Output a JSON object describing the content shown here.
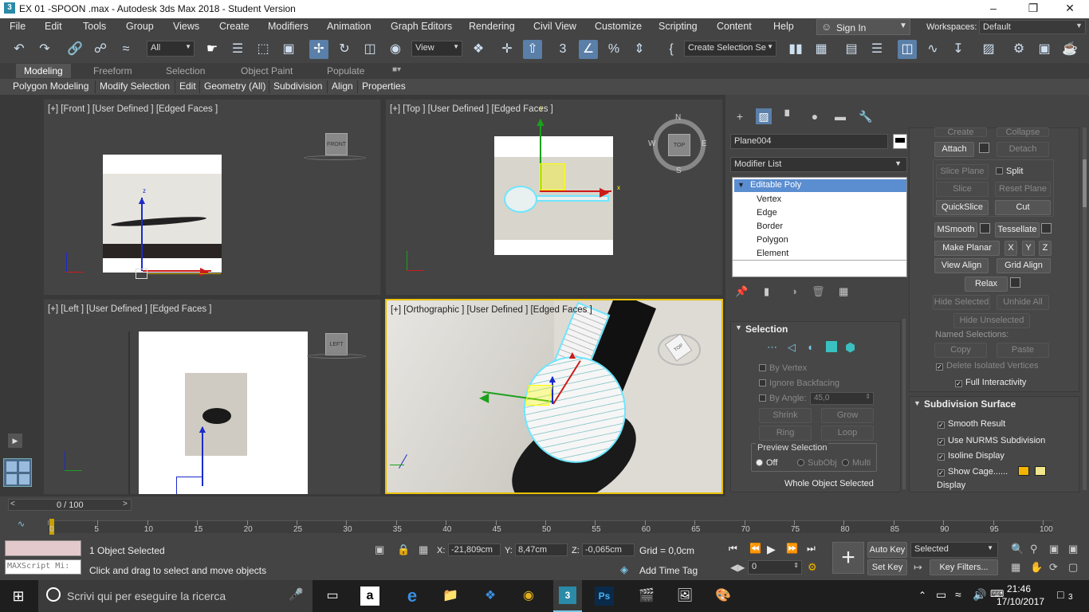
{
  "window": {
    "title": "EX 01 -SPOON .max - Autodesk 3ds Max 2018 - Student Version"
  },
  "menu": [
    "File",
    "Edit",
    "Tools",
    "Group",
    "Views",
    "Create",
    "Modifiers",
    "Animation",
    "Graph Editors",
    "Rendering",
    "Civil View",
    "Customize",
    "Scripting",
    "Content",
    "Help"
  ],
  "signin": "Sign In",
  "workspaces": {
    "label": "Workspaces:",
    "value": "Default"
  },
  "toolbar": {
    "filter": "All",
    "refcoord": "View",
    "selset": "Create Selection Se"
  },
  "ribbon_tabs": [
    "Modeling",
    "Freeform",
    "Selection",
    "Object Paint",
    "Populate"
  ],
  "ribbon_buttons": [
    "Polygon Modeling",
    "Modify Selection",
    "Edit",
    "Geometry (All)",
    "Subdivision",
    "Align",
    "Properties"
  ],
  "viewports": {
    "front": "[+] [Front ] [User Defined ] [Edged Faces ]",
    "top": "[+] [Top ] [User Defined ] [Edged Faces ]",
    "left": "[+] [Left ] [User Defined ] [Edged Faces ]",
    "persp": "[+] [Orthographic ] [User Defined ] [Edged Faces ]"
  },
  "viewcube": {
    "front": "FRONT",
    "top": "TOP",
    "left": "LEFT",
    "n": "N",
    "s": "S",
    "e": "E",
    "w": "W"
  },
  "panel": {
    "object_name": "Plane004",
    "modifier_list": "Modifier List",
    "stack": [
      "Editable Poly",
      "Vertex",
      "Edge",
      "Border",
      "Polygon",
      "Element"
    ]
  },
  "selection": {
    "title": "Selection",
    "by_vertex": "By Vertex",
    "ignore_backfacing": "Ignore Backfacing",
    "by_angle": "By Angle:",
    "angle": "45,0",
    "shrink": "Shrink",
    "grow": "Grow",
    "ring": "Ring",
    "loop": "Loop",
    "preview": "Preview Selection",
    "off": "Off",
    "subobj": "SubObj",
    "multi": "Multi",
    "status": "Whole Object Selected"
  },
  "edit_geometry": {
    "create": "Create",
    "collapse": "Collapse",
    "attach": "Attach",
    "detach": "Detach",
    "slice_plane": "Slice Plane",
    "split": "Split",
    "slice": "Slice",
    "reset_plane": "Reset Plane",
    "quickslice": "QuickSlice",
    "cut": "Cut",
    "msmooth": "MSmooth",
    "tessellate": "Tessellate",
    "make_planar": "Make Planar",
    "x": "X",
    "y": "Y",
    "z": "Z",
    "view_align": "View Align",
    "grid_align": "Grid Align",
    "relax": "Relax",
    "hide_selected": "Hide Selected",
    "unhide_all": "Unhide All",
    "hide_unselected": "Hide Unselected",
    "named_sel": "Named Selections:",
    "copy": "Copy",
    "paste": "Paste",
    "delete_iso": "Delete Isolated Vertices",
    "full_inter": "Full Interactivity"
  },
  "subdivision": {
    "title": "Subdivision Surface",
    "smooth_result": "Smooth Result",
    "nurms": "Use NURMS Subdivision",
    "isoline": "Isoline Display",
    "show_cage": "Show Cage......",
    "display": "Display",
    "cage_color1": "#f5b400",
    "cage_color2": "#f0e68c"
  },
  "timeline": {
    "frame": "0 / 100",
    "ticks": [
      "0",
      "5",
      "10",
      "15",
      "20",
      "25",
      "30",
      "35",
      "40",
      "45",
      "50",
      "55",
      "60",
      "65",
      "70",
      "75",
      "80",
      "85",
      "90",
      "95",
      "100"
    ]
  },
  "status": {
    "selected": "1 Object Selected",
    "prompt": "Click and drag to select and move objects",
    "x_label": "X:",
    "x": "-21,809cm",
    "y_label": "Y:",
    "y": "8,47cm",
    "z_label": "Z:",
    "z": "-0,065cm",
    "grid": "Grid = 0,0cm",
    "add_time_tag": "Add Time Tag",
    "autokey": "Auto Key",
    "setkey": "Set Key",
    "keymode": "Selected",
    "keyfilters": "Key Filters...",
    "frame_field": "0",
    "maxscript": "MAXScript Mi:"
  },
  "taskbar": {
    "search": "Scrivi qui per eseguire la ricerca",
    "time": "21:46",
    "date": "17/10/2017",
    "notif": "3"
  }
}
